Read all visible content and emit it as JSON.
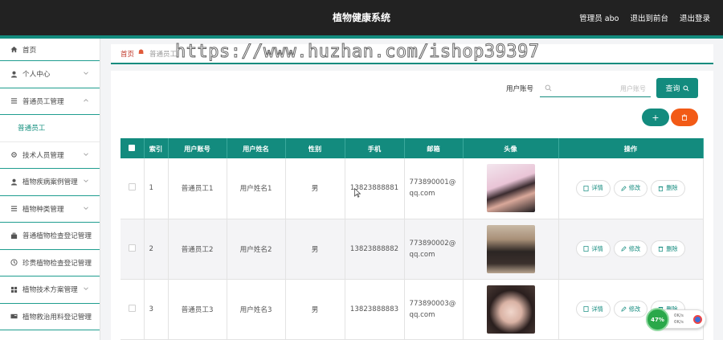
{
  "header": {
    "title": "植物健康系统",
    "admin_label": "管理员 abo",
    "front_label": "退出到前台",
    "logout_label": "退出登录"
  },
  "sidebar": {
    "items": [
      {
        "label": "首页",
        "icon": "home-icon"
      },
      {
        "label": "个人中心",
        "icon": "user-icon"
      },
      {
        "label": "普通员工管理",
        "icon": "list-icon"
      },
      {
        "label": "普通员工",
        "icon": ""
      },
      {
        "label": "技术人员管理",
        "icon": "gear-icon"
      },
      {
        "label": "植物疾病案例管理",
        "icon": "user-icon"
      },
      {
        "label": "植物种类管理",
        "icon": "list-icon"
      },
      {
        "label": "普通植物检查登记管理",
        "icon": "briefcase-icon"
      },
      {
        "label": "珍贵植物检查登记管理",
        "icon": "clock-icon"
      },
      {
        "label": "植物技术方案管理",
        "icon": "grid-icon"
      },
      {
        "label": "植物救治用料登记管理",
        "icon": "card-icon"
      }
    ]
  },
  "breadcrumb": {
    "home": "首页",
    "current": "普通员工"
  },
  "watermark": "https://www.huzhan.com/ishop39397",
  "search": {
    "label": "用户账号",
    "placeholder": "用户账号",
    "button": "查询"
  },
  "actions": {
    "add": "+",
    "delete_icon": "trash-icon"
  },
  "table": {
    "columns": [
      "索引",
      "用户账号",
      "用户姓名",
      "性别",
      "手机",
      "邮箱",
      "头像",
      "操作"
    ],
    "rows": [
      {
        "index": "1",
        "account": "普通员工1",
        "name": "用户姓名1",
        "gender": "男",
        "phone": "13823888881",
        "email": "773890001@qq.com"
      },
      {
        "index": "2",
        "account": "普通员工2",
        "name": "用户姓名2",
        "gender": "男",
        "phone": "13823888882",
        "email": "773890002@qq.com"
      },
      {
        "index": "3",
        "account": "普通员工3",
        "name": "用户姓名3",
        "gender": "男",
        "phone": "13823888883",
        "email": "773890003@qq.com"
      }
    ],
    "ops": {
      "detail": "详情",
      "edit": "修改",
      "delete": "删除"
    }
  },
  "widget": {
    "percent": "47%",
    "line1": "0K/s",
    "line2": "0K/s"
  },
  "colors": {
    "accent": "#138b7e",
    "danger": "#f25a16",
    "topbar": "#222222"
  }
}
